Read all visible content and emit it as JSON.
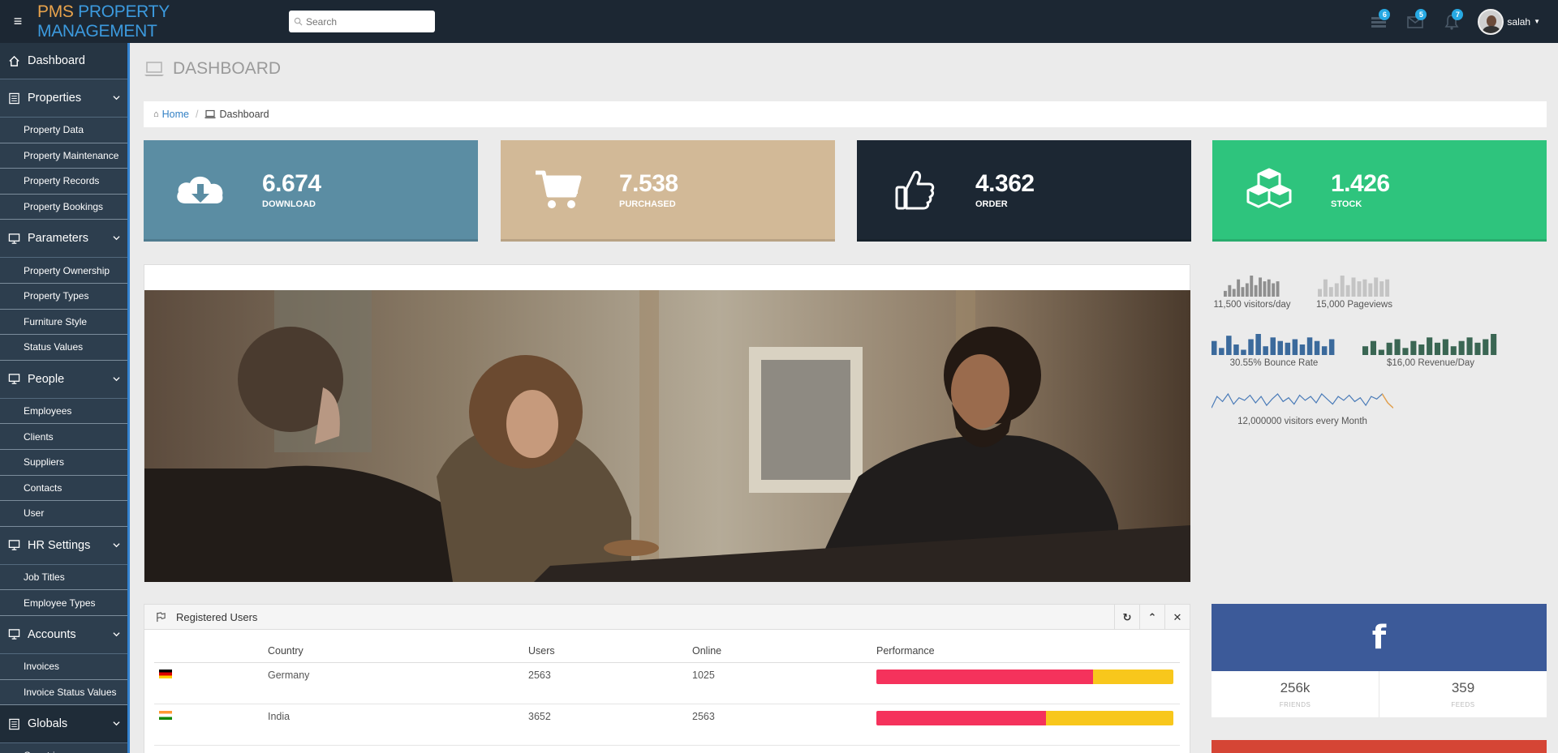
{
  "brand": {
    "part1": "PMS",
    "part2": "PROPERTY MANAGEMENT"
  },
  "search": {
    "placeholder": "Search",
    "value": ""
  },
  "topbar": {
    "tasks_count": "6",
    "messages_count": "5",
    "notifications_count": "7",
    "user_name": "salah"
  },
  "sidebar": {
    "dashboard": "Dashboard",
    "groups": [
      {
        "label": "Properties",
        "items": [
          "Property Data",
          "Property Maintenance",
          "Property Records",
          "Property Bookings"
        ]
      },
      {
        "label": "Parameters",
        "items": [
          "Property Ownership",
          "Property Types",
          "Furniture Style",
          "Status Values"
        ]
      },
      {
        "label": "People",
        "items": [
          "Employees",
          "Clients",
          "Suppliers",
          "Contacts",
          "User"
        ]
      },
      {
        "label": "HR Settings",
        "items": [
          "Job Titles",
          "Employee Types"
        ]
      },
      {
        "label": "Accounts",
        "items": [
          "Invoices",
          "Invoice Status Values"
        ]
      },
      {
        "label": "Globals",
        "items": [
          "Countries"
        ]
      }
    ]
  },
  "page": {
    "title": "DASHBOARD"
  },
  "breadcrumb": {
    "home": "Home",
    "current": "Dashboard"
  },
  "stats": [
    {
      "value": "6.674",
      "label": "DOWNLOAD",
      "color": "#5b8da3"
    },
    {
      "value": "7.538",
      "label": "PURCHASED",
      "color": "#d2b997"
    },
    {
      "value": "4.362",
      "label": "ORDER",
      "color": "#1c2733"
    },
    {
      "value": "1.426",
      "label": "STOCK",
      "color": "#2ec47d"
    }
  ],
  "sparklines": {
    "visitors_day": {
      "label": "11,500 visitors/day",
      "values": [
        3,
        6,
        4,
        9,
        5,
        7,
        11,
        6,
        10,
        8,
        9,
        7,
        8
      ],
      "color": "#8f8f8f"
    },
    "pageviews": {
      "label": "15,000 Pageviews",
      "values": [
        4,
        9,
        5,
        7,
        11,
        6,
        10,
        8,
        9,
        7,
        10,
        8,
        9
      ],
      "color": "#c4c4c4"
    },
    "bounce_rate": {
      "label": "30.55% Bounce Rate",
      "values": [
        8,
        4,
        11,
        6,
        3,
        9,
        12,
        5,
        10,
        8,
        7,
        9,
        6,
        10,
        8,
        5,
        9
      ],
      "color": "#3b6a9c"
    },
    "revenue": {
      "label": "$16,00 Revenue/Day",
      "values": [
        5,
        8,
        3,
        7,
        9,
        4,
        8,
        6,
        10,
        7,
        9,
        5,
        8,
        10,
        7,
        9,
        12
      ],
      "color": "#3a6653"
    },
    "visitors_month": {
      "label": "12,000000 visitors every Month",
      "values": [
        3,
        12,
        8,
        14,
        6,
        11,
        9,
        13,
        7,
        12,
        5,
        10,
        14,
        8,
        11,
        6,
        13,
        9,
        12,
        7,
        14,
        10,
        6,
        12,
        9,
        13,
        8,
        11,
        5,
        12,
        10,
        14,
        7,
        3
      ],
      "color": "#4a7bb8",
      "end_color": "#e8a34c"
    }
  },
  "registered_users": {
    "title": "Registered Users",
    "columns": [
      "Country",
      "Users",
      "Online",
      "Performance"
    ],
    "rows": [
      {
        "country": "Germany",
        "users": "2563",
        "online": "1025",
        "performance": 0.73
      },
      {
        "country": "India",
        "users": "3652",
        "online": "2563",
        "performance": 0.57
      }
    ]
  },
  "facebook": {
    "logo": "f",
    "friends": "256k",
    "friends_label": "FRIENDS",
    "feeds": "359",
    "feeds_label": "FEEDS"
  }
}
